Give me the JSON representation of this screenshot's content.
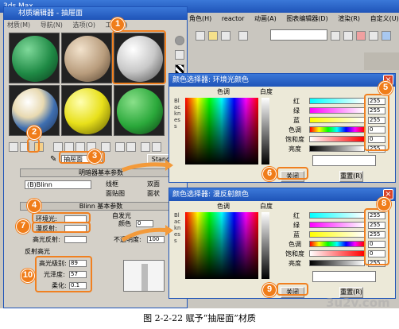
{
  "main_window": {
    "title": "3ds Max",
    "menu": [
      "角色(H)",
      "reactor",
      "动画(A)",
      "图表编辑器(D)",
      "渲染(R)",
      "自定义(U)"
    ]
  },
  "material_editor": {
    "title": "材质编辑器 - 抽屉面",
    "menu": [
      "材质(M)",
      "导航(N)",
      "选项(O)",
      "工具(U)"
    ],
    "material_name": "抽屉面",
    "material_type": "Standard",
    "shader_rollout": "明暗器基本参数",
    "shader_type": "(B)Blinn",
    "shader_options": [
      "线框",
      "双面",
      "面贴图",
      "面状"
    ],
    "blinn_rollout": "Blinn 基本参数",
    "self_illum_group": "自发光",
    "color_label": "颜色",
    "color_value": "0",
    "ambient_label": "环境光:",
    "diffuse_label": "漫反射:",
    "specular_label": "高光反射:",
    "opacity_label": "不透明度:",
    "opacity_value": "100",
    "specular_group": "反射高光",
    "spec_level_label": "高光级别:",
    "spec_level_value": "89",
    "glossiness_label": "光泽度:",
    "glossiness_value": "57",
    "soften_label": "柔化:",
    "soften_value": "0.1"
  },
  "color_picker_ambient": {
    "title": "颜色选择器: 环境光颜色",
    "hue_label": "色调",
    "whiteness_label": "白度",
    "blackness_label": "Blackness",
    "channels": [
      {
        "label": "红",
        "value": "255"
      },
      {
        "label": "绿",
        "value": "255"
      },
      {
        "label": "蓝",
        "value": "255"
      },
      {
        "label": "色调",
        "value": "0"
      },
      {
        "label": "饱和度",
        "value": "0"
      },
      {
        "label": "亮度",
        "value": "255"
      }
    ],
    "close_button": "关闭",
    "reset_button": "重置(R)"
  },
  "color_picker_diffuse": {
    "title": "颜色选择器: 漫反射颜色",
    "hue_label": "色调",
    "whiteness_label": "白度",
    "blackness_label": "Blackness",
    "channels": [
      {
        "label": "红",
        "value": "255"
      },
      {
        "label": "绿",
        "value": "255"
      },
      {
        "label": "蓝",
        "value": "255"
      },
      {
        "label": "色调",
        "value": "0"
      },
      {
        "label": "饱和度",
        "value": "0"
      },
      {
        "label": "亮度",
        "value": "255"
      }
    ],
    "close_button": "关闭",
    "reset_button": "重置(R)"
  },
  "badges": [
    "1",
    "2",
    "3",
    "4",
    "5",
    "6",
    "7",
    "8",
    "9",
    "10"
  ],
  "caption": "图 2-2-22   赋予“抽屉面”材质",
  "watermark": "3u2v.com",
  "colors": {
    "accent_orange": "#f07d1a",
    "title_blue": "#1f54b8"
  }
}
